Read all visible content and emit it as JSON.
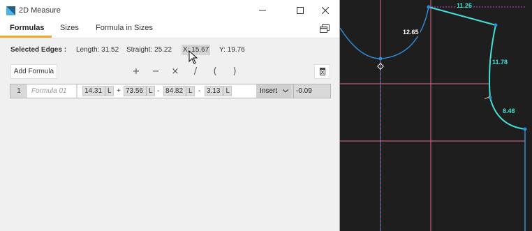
{
  "window": {
    "title": "2D Measure"
  },
  "tabs": [
    {
      "label": "Formulas",
      "active": true
    },
    {
      "label": "Sizes",
      "active": false
    },
    {
      "label": "Formula in Sizes",
      "active": false
    }
  ],
  "selected_edges": {
    "label": "Selected Edges :",
    "length": "Length: 31.52",
    "straight": "Straight: 25.22",
    "x": "X: 15.67",
    "y": "Y: 19.76"
  },
  "toolbar": {
    "add_formula_label": "Add Formula",
    "operators": [
      "+",
      "−",
      "×",
      "/",
      "(",
      ")"
    ]
  },
  "formula": {
    "index": "1",
    "name_placeholder": "Formula 01",
    "terms": [
      {
        "value": "14.31",
        "unit": "L"
      },
      {
        "value": "73.56",
        "unit": "L"
      },
      {
        "value": "84.82",
        "unit": "L"
      },
      {
        "value": "3.13",
        "unit": "L"
      }
    ],
    "signs": [
      "+",
      "-",
      "-"
    ],
    "insert_label": "Insert",
    "result": "-0.09"
  },
  "canvas": {
    "labels": [
      "11.26",
      "12.65",
      "11.78",
      "8.48"
    ]
  },
  "colors": {
    "accent_tab": "#f5a623",
    "pattern_line": "#2e8bd6",
    "selected_line": "#45e0d8",
    "grid_pink": "#e26a8a",
    "dim_magenta": "#d23bd6"
  }
}
